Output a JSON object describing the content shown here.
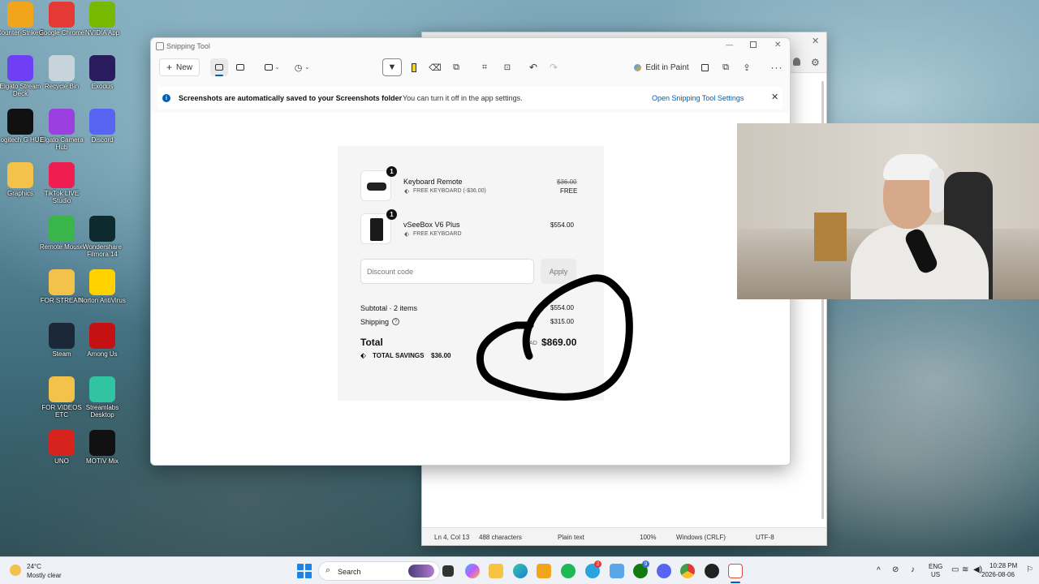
{
  "desktop": {
    "icons": [
      {
        "label": "Counter-Strike 2",
        "icon": "cs2-icon",
        "color": "#f1a51a"
      },
      {
        "label": "Google Chrome",
        "icon": "chrome-icon",
        "color": "#e53935"
      },
      {
        "label": "NVIDIA App",
        "icon": "nvidia-icon",
        "color": "#76b900"
      },
      {
        "label": "Elgato Stream Deck",
        "icon": "stream-deck-icon",
        "color": "#6f3ff5"
      },
      {
        "label": "Recycle Bin",
        "icon": "recycle-bin-icon",
        "color": "#c7d4dc"
      },
      {
        "label": "Exodus",
        "icon": "exodus-icon",
        "color": "#2a1a5e"
      },
      {
        "label": "Logitech G HUB",
        "icon": "logitech-g-icon",
        "color": "#111111"
      },
      {
        "label": "Elgato Camera Hub",
        "icon": "camera-hub-icon",
        "color": "#9b3fe0"
      },
      {
        "label": "Discord",
        "icon": "discord-icon",
        "color": "#5865f2"
      },
      {
        "label": "Graphics",
        "icon": "folder-icon",
        "color": "#f3c24a"
      },
      {
        "label": "TikTok LIVE Studio",
        "icon": "tiktok-live-icon",
        "color": "#ee1d52"
      },
      {
        "label": "Remote Mouse",
        "icon": "remote-mouse-icon",
        "color": "#39b54a"
      },
      {
        "label": "Wondershare Filmora 14",
        "icon": "filmora-icon",
        "color": "#0d2a2e"
      },
      {
        "label": "FOR STREAM",
        "icon": "folder-icon",
        "color": "#f3c24a"
      },
      {
        "label": "Norton AntiVirus",
        "icon": "norton-icon",
        "color": "#ffd200"
      },
      {
        "label": "Steam",
        "icon": "steam-icon",
        "color": "#1b2838"
      },
      {
        "label": "Among Us",
        "icon": "among-us-icon",
        "color": "#c51111"
      },
      {
        "label": "FOR VIDEOS ETC",
        "icon": "folder-icon",
        "color": "#f3c24a"
      },
      {
        "label": "Streamlabs Desktop",
        "icon": "streamlabs-icon",
        "color": "#31c3a2"
      },
      {
        "label": "UNO",
        "icon": "uno-icon",
        "color": "#d6231e"
      },
      {
        "label": "MOTIV Mix",
        "icon": "motiv-mix-icon",
        "color": "#111111"
      }
    ]
  },
  "notepad": {
    "status": {
      "position": "Ln 4, Col 13",
      "characters": "488 characters",
      "format": "Plain text",
      "zoom": "100%",
      "line_endings": "Windows (CRLF)",
      "encoding": "UTF-8"
    }
  },
  "snipping_tool": {
    "title": "Snipping Tool",
    "new_label": "New",
    "edit_in_paint_label": "Edit in Paint",
    "info": {
      "bold": "Screenshots are automatically saved to your Screenshots folder",
      "normal": "You can turn it off in the app settings.",
      "link": "Open Snipping Tool Settings"
    }
  },
  "checkout": {
    "items": [
      {
        "name": "Keyboard Remote",
        "discount": "FREE KEYBOARD (-$36.00)",
        "original_price": "$36.00",
        "price": "FREE",
        "qty": "1"
      },
      {
        "name": "vSeeBox V6 Plus",
        "discount": "FREE KEYBOARD",
        "original_price": "",
        "price": "$554.00",
        "qty": "1"
      }
    ],
    "discount_placeholder": "Discount code",
    "apply_label": "Apply",
    "subtotal_label": "Subtotal · 2 items",
    "subtotal_value": "$554.00",
    "shipping_label": "Shipping",
    "shipping_value": "$315.00",
    "total_label": "Total",
    "currency": "CAD",
    "total_value": "$869.00",
    "savings_label": "TOTAL SAVINGS",
    "savings_value": "$36.00"
  },
  "taskbar": {
    "weather_temp": "24°C",
    "weather_desc": "Mostly clear",
    "search_placeholder": "Search",
    "language": "ENG",
    "region": "US",
    "time": "10:28 PM",
    "date": "2026-08-06",
    "notification_counts": [
      "2",
      "9"
    ]
  },
  "colors": {
    "accent": "#005fb8",
    "ink": "#000000"
  }
}
